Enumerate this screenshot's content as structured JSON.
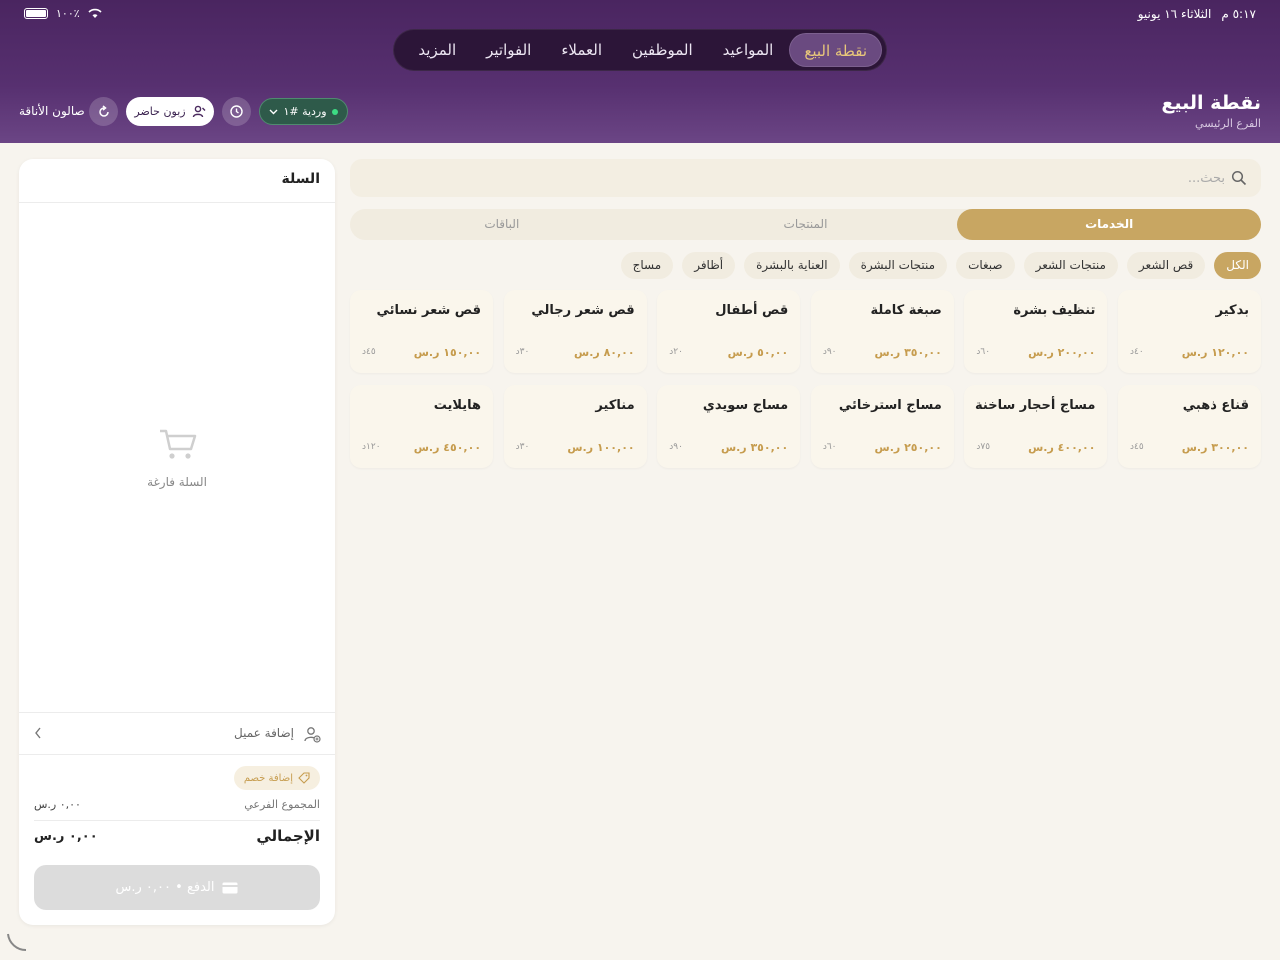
{
  "status_bar": {
    "time": "٥:١٧ م",
    "date": "الثلاثاء ١٦ يونيو",
    "battery": "١٠٠٪"
  },
  "topnav": {
    "items": [
      {
        "label": "نقطة البيع",
        "active": true
      },
      {
        "label": "المواعيد",
        "active": false
      },
      {
        "label": "الموظفين",
        "active": false
      },
      {
        "label": "العملاء",
        "active": false
      },
      {
        "label": "الفواتير",
        "active": false
      },
      {
        "label": "المزيد",
        "active": false
      }
    ]
  },
  "header": {
    "title": "نقطة البيع",
    "subtitle": "الفرع الرئيسي",
    "salon_name": "صالون الأناقة",
    "walkin_label": "زبون حاضر",
    "shift_label": "وردية #١"
  },
  "search": {
    "placeholder": "بحث..."
  },
  "tabs": [
    {
      "label": "الخدمات",
      "active": true
    },
    {
      "label": "المنتجات",
      "active": false
    },
    {
      "label": "الباقات",
      "active": false
    }
  ],
  "categories": [
    {
      "label": "الكل",
      "active": true
    },
    {
      "label": "قص الشعر",
      "active": false
    },
    {
      "label": "منتجات الشعر",
      "active": false
    },
    {
      "label": "صبغات",
      "active": false
    },
    {
      "label": "منتجات البشرة",
      "active": false
    },
    {
      "label": "العناية بالبشرة",
      "active": false
    },
    {
      "label": "أظافر",
      "active": false
    },
    {
      "label": "مساج",
      "active": false
    }
  ],
  "services": [
    {
      "name": "بدكير",
      "price": "١٢٠,٠٠ ر.س",
      "duration": "٤٠د"
    },
    {
      "name": "تنظيف بشرة",
      "price": "٢٠٠,٠٠ ر.س",
      "duration": "٦٠د"
    },
    {
      "name": "صبغة كاملة",
      "price": "٣٥٠,٠٠ ر.س",
      "duration": "٩٠د"
    },
    {
      "name": "قص أطفال",
      "price": "٥٠,٠٠ ر.س",
      "duration": "٢٠د"
    },
    {
      "name": "قص شعر رجالي",
      "price": "٨٠,٠٠ ر.س",
      "duration": "٣٠د"
    },
    {
      "name": "قص شعر نسائي",
      "price": "١٥٠,٠٠ ر.س",
      "duration": "٤٥د"
    },
    {
      "name": "قناع ذهبي",
      "price": "٣٠٠,٠٠ ر.س",
      "duration": "٤٥د"
    },
    {
      "name": "مساج أحجار ساخنة",
      "price": "٤٠٠,٠٠ ر.س",
      "duration": "٧٥د"
    },
    {
      "name": "مساج استرخائي",
      "price": "٢٥٠,٠٠ ر.س",
      "duration": "٦٠د"
    },
    {
      "name": "مساج سويدي",
      "price": "٣٥٠,٠٠ ر.س",
      "duration": "٩٠د"
    },
    {
      "name": "مناكير",
      "price": "١٠٠,٠٠ ر.س",
      "duration": "٣٠د"
    },
    {
      "name": "هايلايت",
      "price": "٤٥٠,٠٠ ر.س",
      "duration": "١٢٠د"
    }
  ],
  "cart": {
    "title": "السلة",
    "empty_text": "السلة فارغة",
    "add_customer_label": "إضافة عميل",
    "discount_label": "إضافة خصم",
    "subtotal_label": "المجموع الفرعي",
    "subtotal_value": "٠,٠٠ ر.س",
    "total_label": "الإجمالي",
    "total_value": "٠,٠٠ ر.س",
    "pay_label": "الدفع • ٠,٠٠ ر.س"
  },
  "colors": {
    "header_purple": "#4a2560",
    "accent_gold": "#c8a662",
    "shift_green": "#2e5a4a"
  }
}
